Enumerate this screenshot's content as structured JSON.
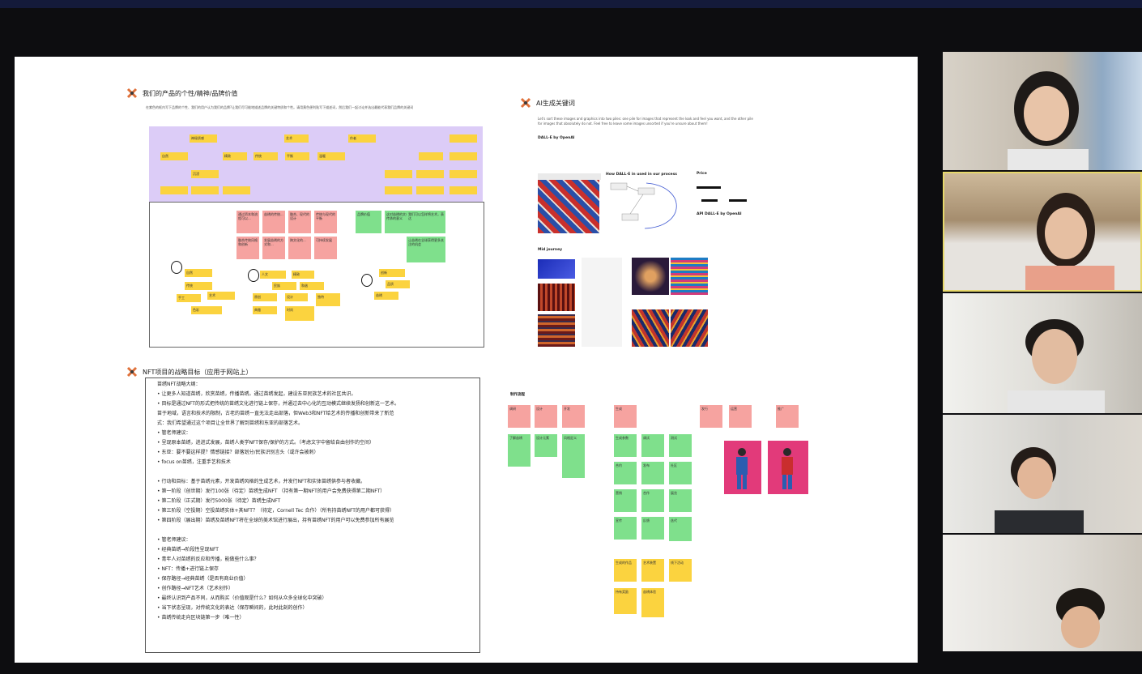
{
  "board": {
    "brand": {
      "title": "我们的产品的个性/精神/品牌价值",
      "description": "在紫色的框内写下品牌的个性、我们的用户认为我们的品牌?让我们尽可能地描述品牌的关键特质和个性。请用黄色便利贴写下描述词，然后我们一起讨论并选出最能代表我们品牌的关键词"
    },
    "ai": {
      "title": "AI生成关键词",
      "description": "Let's sort these images and graphics into two piles: one pile for images that represent the look and feel you want, and the other pile for images that absolutely do not. Feel free to leave some images unsorted if you're unsure about them!",
      "dalle_label": "DALL·E by OpenAI",
      "how_label": "How DALL·E in used in our process",
      "price_label": "Price",
      "api_label": "API DALL·E by OpenAI",
      "mid_label": "Mid journey"
    },
    "nft": {
      "title": "NFT项目的战略目标（应用于网站上）",
      "outline": [
        "苗绣NFT战略大纲：",
        "• 让更多人知道苗绣，欣赏苗绣，传播苗绣。通过苗绣发起，建设东亚民族艺术的社区共识。",
        "• 目标是通过NFT的形式把传统的苗绣文化进行链上保存，并通过去中心化的互动模式继续发扬和创新这一艺术。",
        "   苗于地域，语言和技术的限制，古老的苗绣一直无法走出部落，但Web3和NFT给艺术的传播和创新带来了新范",
        "   式：我们希望通过这个项目让全世界了解到苗绣和东亚的部落艺术。",
        "• 管老师建议：",
        "    • 呈现原本苗绣，进进式发展，苗绣人类学NFT保存/保护的方式。（考虑文字中留给自由创作的空间）",
        "    • 东亚：要不要这样提？情感链接？部落划分/民族识别言头（或许会被刺）",
        "    • focus on苗绣，注重手艺和技术",
        "",
        "• 行动和目标：基于苗绣元素，开发苗绣风格的生成艺术，并发行NFT和实体苗绣供参与者收藏。",
        "    • 第一阶段（创世期）发行100张（待定）苗绣生成NFT （持有第一期NFT的用户会免费获得第二期NFT）",
        "    • 第二阶段（正式期）发行5000张（待定）苗绣生成NFT",
        "    • 第三阶段（空投期）空投苗绣实体+其NFT？（待定，Cornell Tec 合作）（所有持苗绣NFT的用户都可获得）",
        "    • 第四阶段（展出期）苗绣及苗绣NFT将在全球的美术馆进行展出，持有苗绣NFT的用户可以免费参加所有展览",
        "",
        "• 管老师建议：",
        "    • 经典苗绣→阶段性呈现NFT",
        "    • 青年人对苗绣的反应和传播，能做些什么事？",
        "    • NFT：传播+进行链上保存",
        "    • 保存路径→经典苗绣（是否有商业价值）",
        "    • 创作路径→NFT艺术（艺术创作）",
        "    • 最终认识到产品不同，从而购买（价值观是什么？如何从众多全球化中突破）",
        "    • 当下状态呈现，对传统文化的表达（保存瞬间的，此时此刻的创作）",
        "    • 苗绣传统走向区块链第一步（唯一性）"
      ],
      "flow_title": "制作流程"
    },
    "purple_notes": [
      "神秘质感",
      "艺术",
      "作者",
      "自然",
      "精致",
      "传统",
      "平衡",
      "温暖",
      "沉浸"
    ],
    "frame_notes": {
      "pink": [
        "通过资本和流程可以...",
        "苗绣的传统...",
        "融合、现代的设计",
        "传统与现代的平衡",
        "融合传统风格和创新",
        "发展苗绣的方式和...",
        "跨文化的...",
        "可持续发展"
      ],
      "green": [
        "品牌价值",
        "这对苗绣的文化传承的意义",
        "我们可以怎样将艺术，表达",
        "让苗绣在全球获得更多关注的机会"
      ],
      "yellow": [
        "自然",
        "传统",
        "手工",
        "艺术",
        "色彩",
        "人文",
        "精致",
        "民族",
        "和谐",
        "原创",
        "设计",
        "独特",
        "典雅",
        "时尚",
        "创新",
        "品质",
        "苗绣",
        "文化",
        "珍贵",
        "灵动",
        "温暖"
      ]
    },
    "flow_notes": {
      "pink": [
        "调研",
        "设计",
        "开发",
        "生成",
        "发行",
        "运营",
        "推广",
        "展出"
      ],
      "green": [
        "了解苗绣",
        "设计元素",
        "风格定义",
        "生成参数",
        "调试",
        "测试",
        "合约",
        "发布",
        "社区",
        "营销",
        "合作",
        "展览",
        "宣传",
        "反馈",
        "迭代",
        "维护",
        "AI生成",
        "整理",
        "筛选"
      ],
      "yellow": [
        "生成的作品",
        "艺术装置",
        "线下活动",
        "持有奖励",
        "苗绣体验",
        "周边"
      ]
    },
    "colors": {
      "purple_area": "#dcccf7",
      "sticky_yellow": "#fbd33f",
      "sticky_pink": "#f6a3a0",
      "sticky_green": "#7fe08c",
      "active_speaker_border": "#e6d86b"
    }
  },
  "participants": [
    {
      "id": "p1",
      "active": false
    },
    {
      "id": "p2",
      "active": true
    },
    {
      "id": "p3",
      "active": false
    },
    {
      "id": "p4",
      "active": false
    },
    {
      "id": "p5",
      "active": false
    }
  ]
}
